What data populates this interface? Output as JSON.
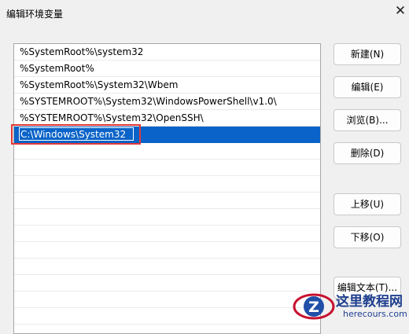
{
  "window": {
    "title": "编辑环境变量",
    "close_glyph": "✕"
  },
  "list": {
    "items": [
      "%SystemRoot%\\system32",
      "%SystemRoot%",
      "%SystemRoot%\\System32\\Wbem",
      "%SYSTEMROOT%\\System32\\WindowsPowerShell\\v1.0\\",
      "%SYSTEMROOT%\\System32\\OpenSSH\\"
    ],
    "editing_value": "C:\\Windows\\System32",
    "selection_color": "#0a63c8"
  },
  "buttons": {
    "new": "新建(N)",
    "edit": "编辑(E)",
    "browse": "浏览(B)...",
    "delete": "删除(D)",
    "move_up": "上移(U)",
    "move_down": "下移(O)",
    "edit_text": "编辑文本(T)..."
  },
  "annotation": {
    "highlight_color": "#e03a3a"
  },
  "watermark": {
    "title": "这里教程网",
    "url": "herecours.com",
    "logo_letter": "Z"
  }
}
